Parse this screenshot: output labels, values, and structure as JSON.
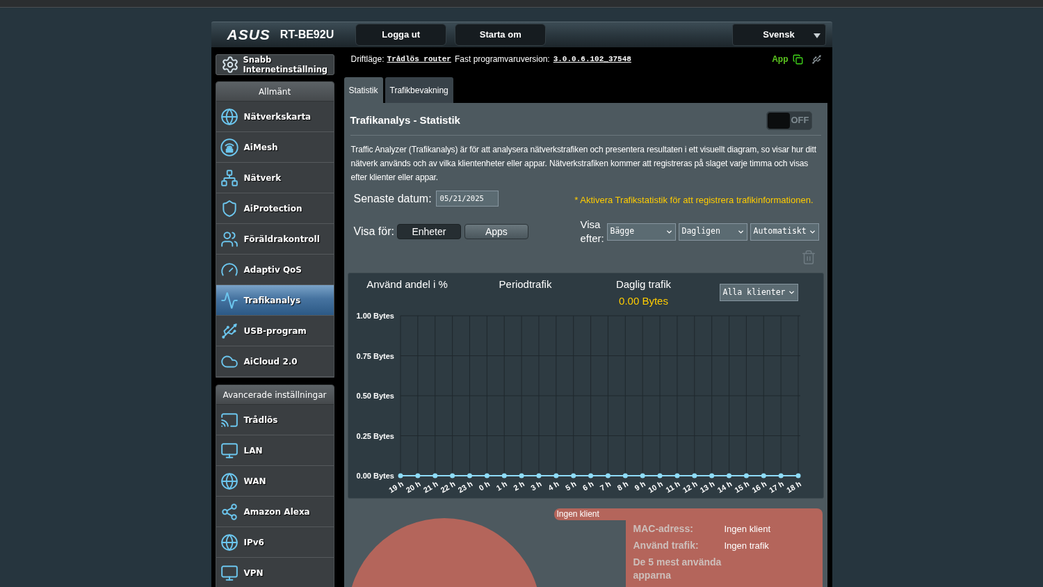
{
  "header": {
    "logo": "ASUS",
    "model": "RT-BE92U",
    "buttons": [
      "Logga ut",
      "Starta om"
    ],
    "language": "Svensk"
  },
  "sidebar": {
    "quick_setup": "Snabb Internetinställning",
    "groups": [
      {
        "title": "Allmänt",
        "items": [
          {
            "label": "Nätverkskarta",
            "selected": false
          },
          {
            "label": "AiMesh",
            "selected": false
          },
          {
            "label": "Nätverk",
            "selected": false
          },
          {
            "label": "AiProtection",
            "selected": false
          },
          {
            "label": "Föräldrakontroll",
            "selected": false
          },
          {
            "label": "Adaptiv QoS",
            "selected": false
          },
          {
            "label": "Trafikanalys",
            "selected": true
          },
          {
            "label": "USB-program",
            "selected": false
          },
          {
            "label": "AiCloud 2.0",
            "selected": false
          }
        ]
      },
      {
        "title": "Avancerade inställningar",
        "items": [
          {
            "label": "Trådlös",
            "selected": false
          },
          {
            "label": "LAN",
            "selected": false
          },
          {
            "label": "WAN",
            "selected": false
          },
          {
            "label": "Amazon Alexa",
            "selected": false
          },
          {
            "label": "IPv6",
            "selected": false
          },
          {
            "label": "VPN",
            "selected": false
          }
        ]
      }
    ]
  },
  "status_line": {
    "mode_label": "Driftläge:",
    "mode": "Trådlös router",
    "firmware_label": "Fast programvaruversion:",
    "firmware": "3.0.0.6.102_37548",
    "app_label": "App"
  },
  "tabs": [
    {
      "label": "Statistik",
      "selected": true
    },
    {
      "label": "Trafikbevakning",
      "selected": false
    }
  ],
  "panel": {
    "title": "Trafikanalys - Statistik",
    "toggle": {
      "on": false,
      "label": "OFF"
    },
    "description": "Traffic Analyzer (Trafikanalys) är för att analysera nätverkstrafiken och presentera resultaten i ett visuellt diagram, so visar hur ditt nätverk används och av vilka klientenheter eller appar. Nätverkstrafiken kommer att registreras på slaget varje timma och visas efter klienter eller appar.",
    "latest_date": {
      "label": "Senaste datum:",
      "value": "05/21/2025"
    },
    "notice": "* Aktivera Trafikstatistik för att registrera trafikinformationen.",
    "show_for": {
      "label": "Visa för:",
      "options": [
        {
          "label": "Enheter",
          "selected": true
        },
        {
          "label": "Apps",
          "selected": false
        }
      ]
    },
    "show_by": {
      "label": "Visa efter:",
      "selects": [
        "Bägge",
        "Dagligen",
        "Automatiskt"
      ]
    }
  },
  "chart_panel": {
    "headings": [
      "Använd andel i %",
      "Periodtrafik",
      "Daglig trafik"
    ],
    "daily_total": "0.00 Bytes",
    "client_select": "Alla klienter",
    "chart_data": {
      "type": "line",
      "grid": true,
      "categories": [
        "19 h",
        "20 h",
        "21 h",
        "22 h",
        "23 h",
        "0 h",
        "1 h",
        "2 h",
        "3 h",
        "4 h",
        "5 h",
        "6 h",
        "7 h",
        "8 h",
        "9 h",
        "10 h",
        "11 h",
        "12 h",
        "13 h",
        "14 h",
        "15 h",
        "16 h",
        "17 h",
        "18 h"
      ],
      "series": [
        {
          "color": "#8fdcf8",
          "marker": true,
          "values": [
            0,
            0,
            0,
            0,
            0,
            0,
            0,
            0,
            0,
            0,
            0,
            0,
            0,
            0,
            0,
            0,
            0,
            0,
            0,
            0,
            0,
            0,
            0,
            0
          ]
        }
      ],
      "ylim": [
        0,
        1
      ],
      "yticks": [
        {
          "value": 0,
          "label": "0.00 Bytes"
        },
        {
          "value": 0.25,
          "label": "0.25 Bytes"
        },
        {
          "value": 0.5,
          "label": "0.50 Bytes"
        },
        {
          "value": 0.75,
          "label": "0.75 Bytes"
        },
        {
          "value": 1,
          "label": "1.00 Bytes"
        }
      ]
    }
  },
  "client_summary": {
    "name": "Ingen klient",
    "fields": [
      {
        "label": "MAC-adress:",
        "value": "Ingen klient"
      },
      {
        "label": "Använd trafik:",
        "value": "Ingen trafik"
      },
      {
        "label": "De 5 mest använda apparna"
      }
    ]
  }
}
